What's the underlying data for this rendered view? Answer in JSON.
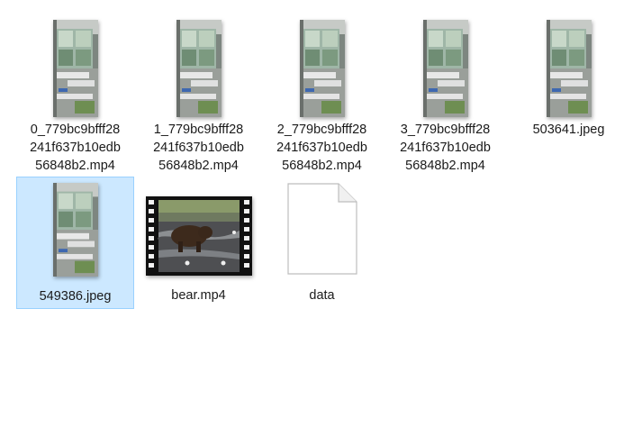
{
  "files": [
    {
      "name_lines": [
        "0_779bc9bfff28",
        "241f637b10edb",
        "56848b2.mp4"
      ],
      "kind": "video-portrait",
      "selected": false
    },
    {
      "name_lines": [
        "1_779bc9bfff28",
        "241f637b10edb",
        "56848b2.mp4"
      ],
      "kind": "video-portrait",
      "selected": false
    },
    {
      "name_lines": [
        "2_779bc9bfff28",
        "241f637b10edb",
        "56848b2.mp4"
      ],
      "kind": "video-portrait",
      "selected": false
    },
    {
      "name_lines": [
        "3_779bc9bfff28",
        "241f637b10edb",
        "56848b2.mp4"
      ],
      "kind": "video-portrait",
      "selected": false
    },
    {
      "name_lines": [
        "503641.jpeg"
      ],
      "kind": "image-portrait",
      "selected": false
    },
    {
      "name_lines": [
        "549386.jpeg"
      ],
      "kind": "image-portrait",
      "selected": true
    },
    {
      "name_lines": [
        "bear.mp4"
      ],
      "kind": "video-bear",
      "selected": false
    },
    {
      "name_lines": [
        "data"
      ],
      "kind": "generic-file",
      "selected": false
    }
  ],
  "colors": {
    "selection_bg": "#cce8ff",
    "selection_border": "#99d1ff"
  }
}
